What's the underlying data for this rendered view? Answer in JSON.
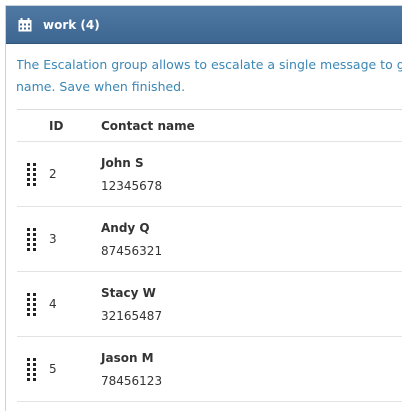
{
  "panel": {
    "title": "work (4)",
    "icon": "calendar-icon",
    "header_color": "#416a94"
  },
  "description": {
    "line1": "The Escalation group allows to escalate a single message to group me",
    "line2": "name. Save when finished."
  },
  "table": {
    "columns": [
      "",
      "ID",
      "Contact name"
    ],
    "rows": [
      {
        "id": "2",
        "name": "John S",
        "phone": "12345678"
      },
      {
        "id": "3",
        "name": "Andy Q",
        "phone": "87456321"
      },
      {
        "id": "4",
        "name": "Stacy W",
        "phone": "32165487"
      },
      {
        "id": "5",
        "name": "Jason M",
        "phone": "78456123"
      }
    ]
  }
}
